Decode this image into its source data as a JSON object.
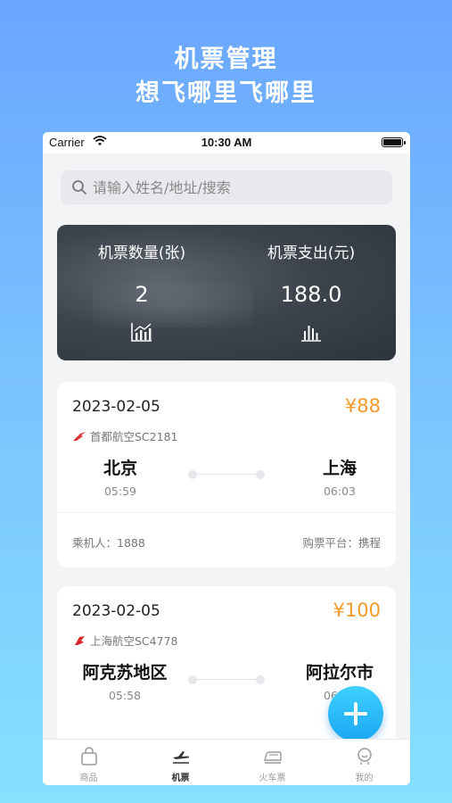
{
  "promo": {
    "line1": "机票管理",
    "line2": "想飞哪里飞哪里"
  },
  "status_bar": {
    "carrier": "Carrier",
    "time": "10:30 AM"
  },
  "search": {
    "placeholder": "请输入姓名/地址/搜索"
  },
  "stats": {
    "count_label": "机票数量(张)",
    "count_value": "2",
    "spend_label": "机票支出(元)",
    "spend_value": "188.0"
  },
  "tickets": [
    {
      "date": "2023-02-05",
      "price": "¥88",
      "airline": "首都航空SC2181",
      "from_city": "北京",
      "from_time": "05:59",
      "to_city": "上海",
      "to_time": "06:03",
      "passenger": "乘机人：1888",
      "platform": "购票平台：携程"
    },
    {
      "date": "2023-02-05",
      "price": "¥100",
      "airline": "上海航空SC4778",
      "from_city": "阿克苏地区",
      "from_time": "05:58",
      "to_city": "阿拉尔市",
      "to_time": "06:02"
    }
  ],
  "tabs": [
    {
      "label": "商品",
      "icon": "bag-icon"
    },
    {
      "label": "机票",
      "icon": "plane-icon"
    },
    {
      "label": "火车票",
      "icon": "train-icon"
    },
    {
      "label": "我的",
      "icon": "profile-icon"
    }
  ],
  "colors": {
    "price": "#f39a2b",
    "fab": "#1aa7f2",
    "background_top": "#6aa6ff",
    "background_bottom": "#86e0ff"
  }
}
